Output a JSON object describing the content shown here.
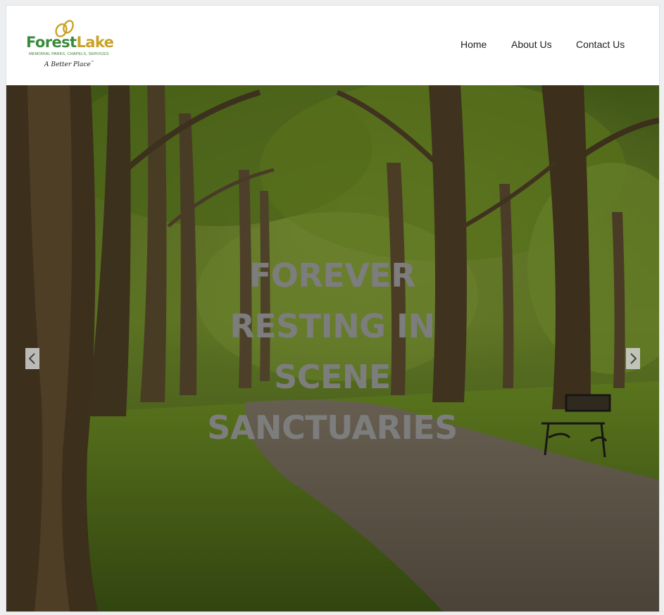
{
  "brand": {
    "name_part1": "Forest",
    "name_part2": "Lake",
    "tagline": "MEMORIAL PARKS, CHAPELS, SERVICES",
    "slogan": "A Better Place",
    "slogan_mark": "™",
    "color_green": "#3a8a3a",
    "color_gold": "#c9a227"
  },
  "nav": {
    "items": [
      {
        "label": "Home"
      },
      {
        "label": "About Us"
      },
      {
        "label": "Contact Us"
      }
    ]
  },
  "hero": {
    "title_lines": [
      "FOREVER",
      "RESTING IN",
      "SCENE",
      "SANCTUARIES"
    ],
    "title_color": "#7d7d7d",
    "prev_icon": "chevron-left-icon",
    "next_icon": "chevron-right-icon",
    "background": "tree-lined park path with bench"
  }
}
